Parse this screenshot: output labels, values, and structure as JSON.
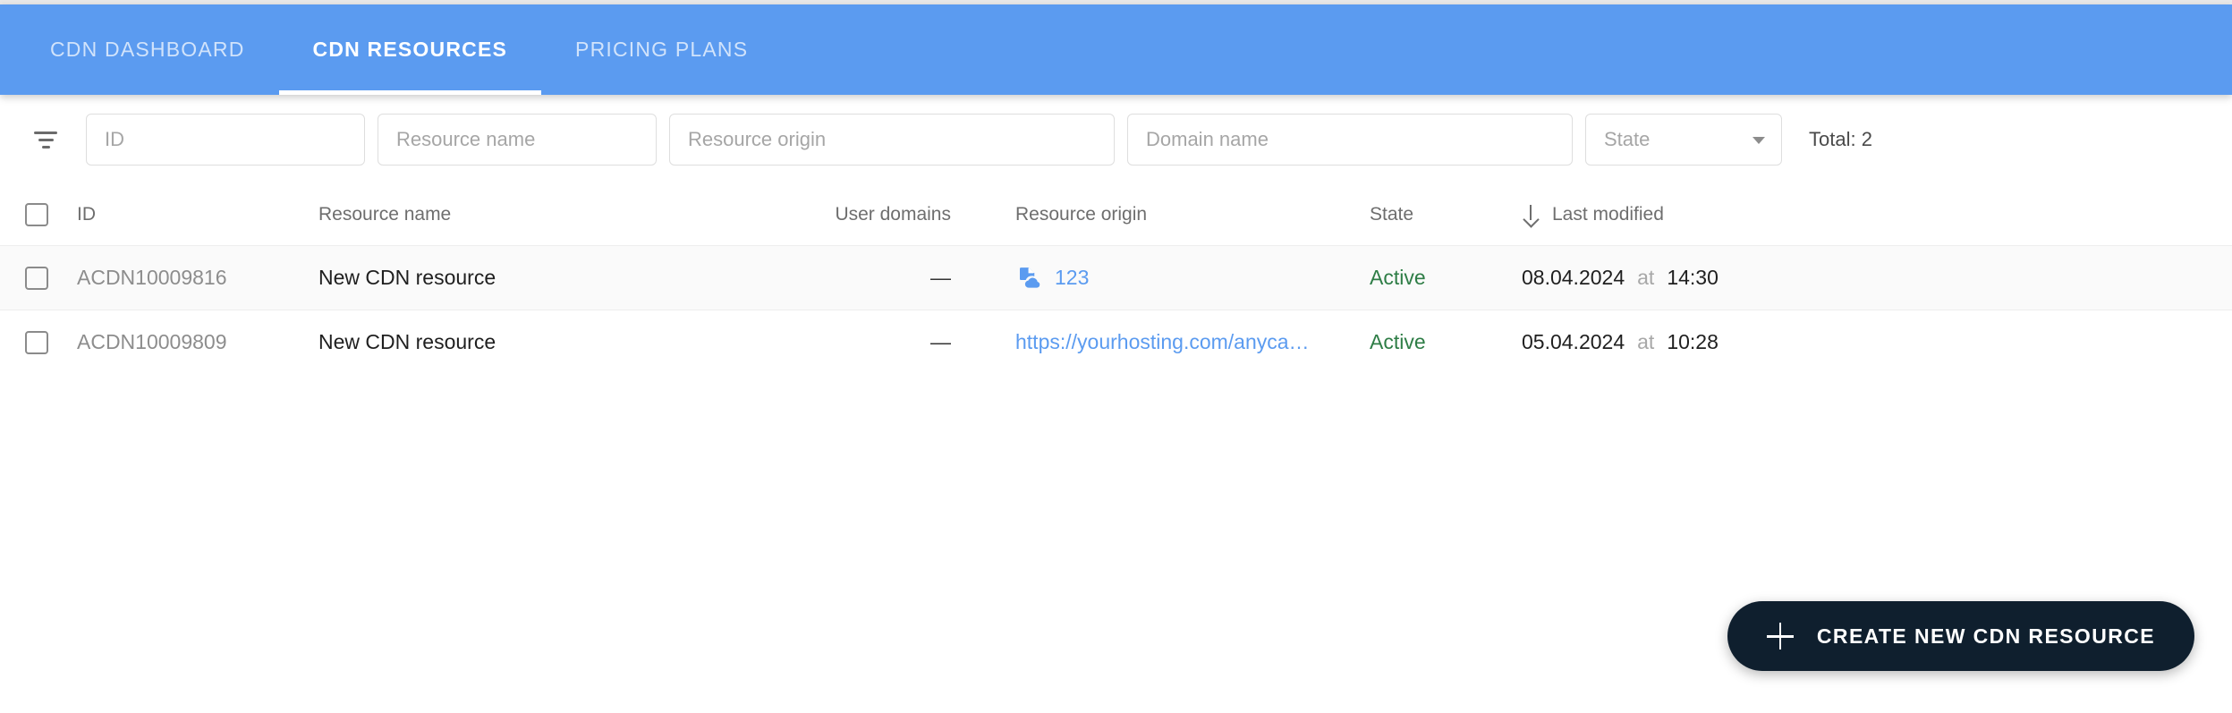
{
  "header": {
    "tabs": [
      {
        "label": "CDN DASHBOARD",
        "active": false
      },
      {
        "label": "CDN RESOURCES",
        "active": true
      },
      {
        "label": "PRICING PLANS",
        "active": false
      }
    ],
    "accent_color": "#5b9bf0"
  },
  "filters": {
    "filter_icon": "filter-icon",
    "id": {
      "placeholder": "ID",
      "value": ""
    },
    "resource_name": {
      "placeholder": "Resource name",
      "value": ""
    },
    "resource_origin": {
      "placeholder": "Resource origin",
      "value": ""
    },
    "domain_name": {
      "placeholder": "Domain name",
      "value": ""
    },
    "state": {
      "placeholder": "State",
      "value": "",
      "caret_icon": "chevron-down-icon"
    },
    "total_label": "Total: 2"
  },
  "table": {
    "columns": {
      "id": "ID",
      "resource_name": "Resource name",
      "user_domains": "User domains",
      "resource_origin": "Resource origin",
      "state": "State",
      "last_modified": "Last modified"
    },
    "sort": {
      "column": "Last modified",
      "direction": "descending",
      "icon": "arrow-down-icon"
    },
    "rows": [
      {
        "id": "ACDN10009816",
        "resource_name": "New CDN resource",
        "user_domains": "—",
        "resource_origin": "123",
        "origin_icon": "cloud-storage-icon",
        "state": "Active",
        "state_color": "#2e7d46",
        "date": "08.04.2024",
        "at": "at",
        "time": "14:30"
      },
      {
        "id": "ACDN10009809",
        "resource_name": "New CDN resource",
        "user_domains": "—",
        "resource_origin": "https://yourhosting.com/anyca…",
        "origin_icon": "",
        "state": "Active",
        "state_color": "#2e7d46",
        "date": "05.04.2024",
        "at": "at",
        "time": "10:28"
      }
    ]
  },
  "actions": {
    "create_button": {
      "label": "CREATE NEW CDN RESOURCE",
      "icon": "plus-icon"
    }
  }
}
